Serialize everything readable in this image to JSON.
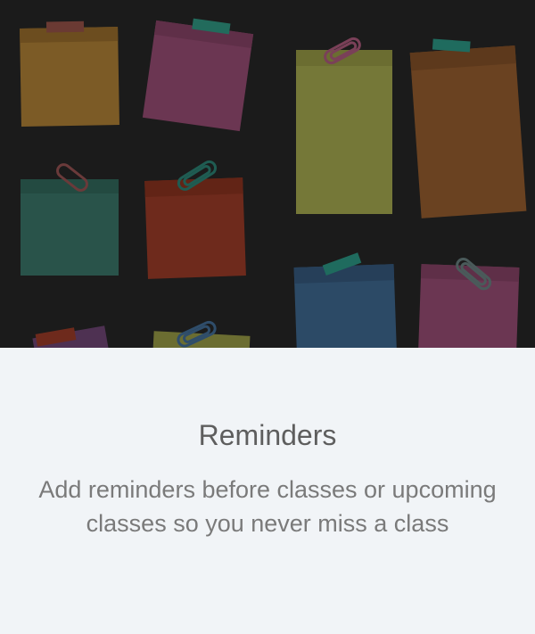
{
  "onboarding": {
    "title": "Reminders",
    "description": "Add reminders before classes or upcoming classes so you never miss a class"
  },
  "colors": {
    "background_dark": "#1b1b1b",
    "panel": "#f1f4f7",
    "title_text": "#5e5e5e",
    "body_text": "#7a7a7a"
  },
  "illustration": {
    "icon": "sticky-notes-board",
    "notes": [
      "orange",
      "pink",
      "olive",
      "brown",
      "teal",
      "red",
      "blue",
      "pink",
      "red",
      "purple",
      "olive"
    ]
  }
}
